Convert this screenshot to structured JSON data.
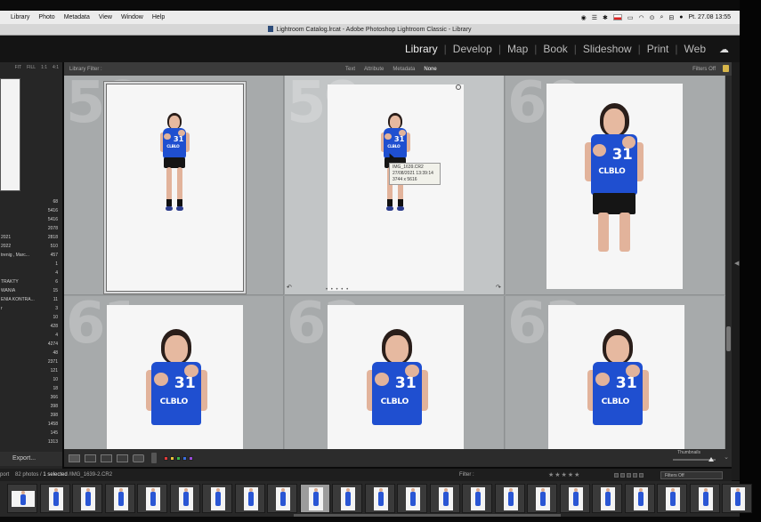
{
  "menubar": {
    "items": [
      "Library",
      "Photo",
      "Metadata",
      "View",
      "Window",
      "Help"
    ],
    "clock": "Pt. 27.08  13:55"
  },
  "window": {
    "title": "Lightroom Catalog.lrcat - Adobe Photoshop Lightroom Classic - Library"
  },
  "modules": [
    "Library",
    "Develop",
    "Map",
    "Book",
    "Slideshow",
    "Print",
    "Web"
  ],
  "active_module": "Library",
  "navigator": {
    "zoom_options": [
      "FIT",
      "FILL",
      "1:1",
      "4:1"
    ]
  },
  "folders": [
    {
      "name": "",
      "count": "68"
    },
    {
      "name": "",
      "count": "5416"
    },
    {
      "name": "",
      "count": "5416"
    },
    {
      "name": "",
      "count": "2078"
    },
    {
      "name": "2021",
      "count": "2818"
    },
    {
      "name": "2022",
      "count": "510"
    },
    {
      "name": "trenig , Marc...",
      "count": "457"
    },
    {
      "name": "",
      "count": "1"
    },
    {
      "name": "",
      "count": "4"
    },
    {
      "name": "TRAKTY",
      "count": "6"
    },
    {
      "name": "WANIA",
      "count": "15"
    },
    {
      "name": "ENIA KONTRA...",
      "count": "11"
    },
    {
      "name": "r",
      "count": "3"
    },
    {
      "name": "",
      "count": "10"
    },
    {
      "name": "",
      "count": "428"
    },
    {
      "name": "",
      "count": "4"
    },
    {
      "name": "",
      "count": "4274"
    },
    {
      "name": "",
      "count": "48"
    },
    {
      "name": "",
      "count": "2371"
    },
    {
      "name": "",
      "count": "121"
    },
    {
      "name": "",
      "count": "10"
    },
    {
      "name": "",
      "count": "18"
    },
    {
      "name": "",
      "count": "366"
    },
    {
      "name": "",
      "count": "398"
    },
    {
      "name": "",
      "count": "398"
    },
    {
      "name": "",
      "count": "1458"
    },
    {
      "name": "",
      "count": "145"
    },
    {
      "name": "",
      "count": "1313"
    }
  ],
  "export_label": "Export...",
  "filterbar": {
    "title": "Library Filter :",
    "tabs": [
      "Text",
      "Attribute",
      "Metadata",
      "None"
    ],
    "active_tab": "None",
    "status": "Filters Off"
  },
  "grid": {
    "cells": [
      {
        "number": "58",
        "selected": false,
        "pose": "full"
      },
      {
        "number": "59",
        "selected": true,
        "pose": "full"
      },
      {
        "number": "60",
        "selected": false,
        "pose": "upper"
      },
      {
        "number": "61",
        "selected": false,
        "pose": "half"
      },
      {
        "number": "62",
        "selected": false,
        "pose": "half"
      },
      {
        "number": "63",
        "selected": false,
        "pose": "half"
      }
    ],
    "jersey_number": "31",
    "jersey_text": "CLBLO"
  },
  "tooltip": {
    "filename": "IMG_1639.CR2",
    "datetime": "27/08/2021 13:39:14",
    "dimensions": "3744 x 5616"
  },
  "toolbar": {
    "thumbnails_label": "Thumbnails",
    "label_colors": [
      "#e03a3a",
      "#e8c23a",
      "#3ab84a",
      "#3a6ee0",
      "#9a4ad8"
    ]
  },
  "filmstrip": {
    "info_prefix": "port",
    "photo_count": "82 photos / ",
    "selected": "1 selected",
    "current_file": " /IMG_1639-2.CR2",
    "filter_label": "Filter :",
    "stars": "★★★★★",
    "filters_off": "Filters Off",
    "thumb_count": 23
  }
}
